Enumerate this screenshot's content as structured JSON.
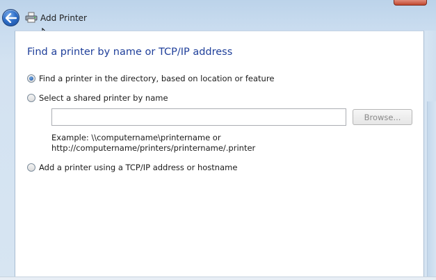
{
  "window": {
    "title": "Add Printer"
  },
  "icons": {
    "back": "back-arrow-icon",
    "printer": "printer-icon",
    "cursor": "mouse-cursor-icon"
  },
  "page": {
    "heading": "Find a printer by name or TCP/IP address",
    "options": [
      {
        "label": "Find a printer in the directory, based on location or feature",
        "selected": true
      },
      {
        "label": "Select a shared printer by name",
        "selected": false
      },
      {
        "label": "Add a printer using a TCP/IP address or hostname",
        "selected": false
      }
    ],
    "shared_printer_input": {
      "value": "",
      "placeholder": ""
    },
    "browse_label": "Browse...",
    "example_line1": "Example: \\\\computername\\printername or",
    "example_line2": "http://computername/printers/printername/.printer"
  },
  "colors": {
    "heading": "#1f3f9a",
    "background": "#d3e2f1",
    "panel": "#ffffff"
  }
}
